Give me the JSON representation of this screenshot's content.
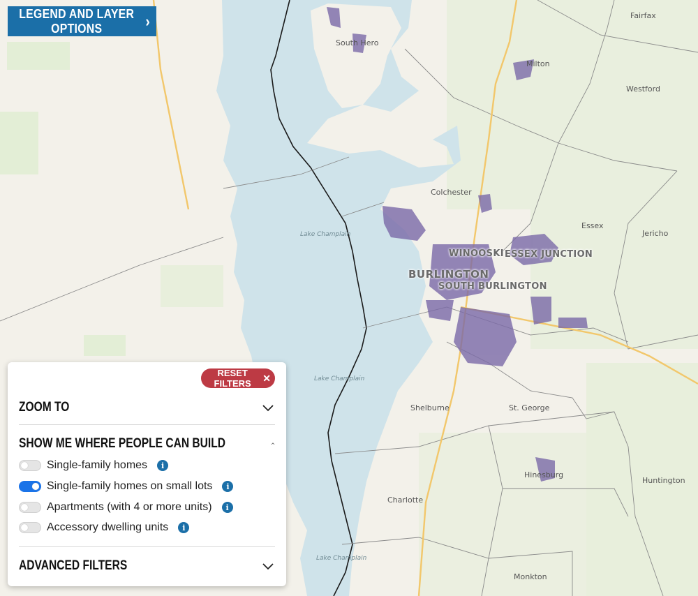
{
  "legend_button": {
    "label": "LEGEND AND LAYER OPTIONS",
    "icon": "chevron-right-icon"
  },
  "map": {
    "water_color": "#cfe3ea",
    "land_color": "#f3f1ea",
    "zoning_color": "#7b6aa8",
    "places": {
      "south_hero": "South Hero",
      "milton": "Milton",
      "fairfax": "Fairfax",
      "westford": "Westford",
      "colchester": "Colchester",
      "essex": "Essex",
      "jericho": "Jericho",
      "winooski": "WINOOSKI",
      "essex_junction": "ESSEX JUNCTION",
      "burlington": "BURLINGTON",
      "south_burlington": "SOUTH BURLINGTON",
      "shelburne": "Shelburne",
      "st_george": "St. George",
      "hinesburg": "Hinesburg",
      "huntington": "Huntington",
      "charlotte": "Charlotte",
      "monkton": "Monkton",
      "lake1": "Lake Champlain",
      "lake2": "Lake Champlain",
      "lake3": "Lake Champlain"
    }
  },
  "panel": {
    "reset_label": "RESET FILTERS",
    "reset_icon": "close-icon",
    "zoom_to": {
      "title": "ZOOM TO",
      "expanded": false
    },
    "show_me": {
      "title": "SHOW ME WHERE PEOPLE CAN BUILD",
      "expanded": true
    },
    "options": [
      {
        "label": "Single-family homes",
        "enabled": false
      },
      {
        "label": "Single-family homes on small lots",
        "enabled": true
      },
      {
        "label": "Apartments (with 4 or more units)",
        "enabled": false
      },
      {
        "label": "Accessory dwelling units",
        "enabled": false
      }
    ],
    "advanced": {
      "title": "ADVANCED FILTERS",
      "expanded": false
    },
    "info_glyph": "i"
  }
}
